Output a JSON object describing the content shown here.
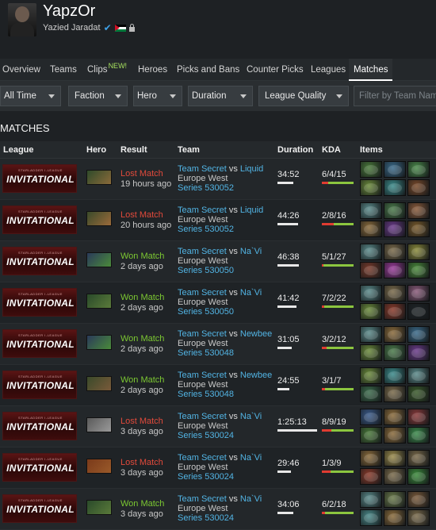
{
  "profile": {
    "player_name": "YapzOr",
    "real_name": "Yazied Jaradat",
    "verified_icon": "check-icon",
    "flag": "jordan-flag-icon",
    "lock_icon": "lock-icon"
  },
  "nav": {
    "tabs": [
      {
        "label": "Overview"
      },
      {
        "label": "Teams"
      },
      {
        "label": "Clips",
        "badge": "NEW!"
      },
      {
        "label": "Heroes"
      },
      {
        "label": "Picks and Bans"
      },
      {
        "label": "Counter Picks"
      },
      {
        "label": "Leagues"
      },
      {
        "label": "Matches",
        "active": true
      }
    ]
  },
  "filters": {
    "time": "All Time",
    "faction": "Faction",
    "hero": "Hero",
    "duration": "Duration",
    "league_quality": "League Quality",
    "search_placeholder": "Filter by Team Name"
  },
  "section_title": "MATCHES",
  "table": {
    "headers": {
      "league": "League",
      "hero": "Hero",
      "result": "Result",
      "team": "Team",
      "duration": "Duration",
      "kda": "KDA",
      "items": "Items"
    },
    "league_banner": {
      "small": "STARLADDER I-LEAGUE",
      "big": "INVITATIONAL"
    },
    "rows": [
      {
        "result": "Lost Match",
        "outcome": "lost",
        "time": "19 hours ago",
        "team": "Team Secret",
        "vs": "vs",
        "opponent": "Liquid",
        "region": "Europe West",
        "series": "Series 530052",
        "duration": "34:52",
        "duration_seconds": 2092,
        "kda": "6/4/15",
        "kills": 6,
        "deaths": 4,
        "assists": 15,
        "hero_colors": [
          "#2f4a2a",
          "#8a6a3a"
        ],
        "item_colors": [
          "#4a7a3a",
          "#3a6a8a",
          "#4a8a4a",
          "#6a8a3a",
          "#3a8a8a",
          "#7a4a2a"
        ]
      },
      {
        "result": "Lost Match",
        "outcome": "lost",
        "time": "20 hours ago",
        "team": "Team Secret",
        "vs": "vs",
        "opponent": "Liquid",
        "region": "Europe West",
        "series": "Series 530052",
        "duration": "44:26",
        "duration_seconds": 2666,
        "kda": "2/8/16",
        "kills": 2,
        "deaths": 8,
        "assists": 16,
        "hero_colors": [
          "#3a4a2a",
          "#9a6a3a"
        ],
        "item_colors": [
          "#5a8a8a",
          "#4a7a4a",
          "#8a5a3a",
          "#8a6a3a",
          "#6a3a8a",
          "#7a5a2a"
        ]
      },
      {
        "result": "Won Match",
        "outcome": "won",
        "time": "2 days ago",
        "team": "Team Secret",
        "vs": "vs",
        "opponent": "Na`Vi",
        "region": "Europe West",
        "series": "Series 530050",
        "duration": "46:38",
        "duration_seconds": 2798,
        "kda": "5/1/27",
        "kills": 5,
        "deaths": 1,
        "assists": 27,
        "hero_colors": [
          "#2a3a5a",
          "#4a8a3a"
        ],
        "item_colors": [
          "#5a8a8a",
          "#7a6a4a",
          "#8a8a3a",
          "#7a3a2a",
          "#9a3a9a",
          "#4a8a3a"
        ]
      },
      {
        "result": "Won Match",
        "outcome": "won",
        "time": "2 days ago",
        "team": "Team Secret",
        "vs": "vs",
        "opponent": "Na`Vi",
        "region": "Europe West",
        "series": "Series 530050",
        "duration": "41:42",
        "duration_seconds": 2502,
        "kda": "7/2/22",
        "kills": 7,
        "deaths": 2,
        "assists": 22,
        "hero_colors": [
          "#2a4a2a",
          "#5a7a3a"
        ],
        "item_colors": [
          "#5a8a8a",
          "#7a6a4a",
          "#8a5a7a",
          "#6a8a3a",
          "#8a3a2a",
          "#1e2326"
        ]
      },
      {
        "result": "Won Match",
        "outcome": "won",
        "time": "2 days ago",
        "team": "Team Secret",
        "vs": "vs",
        "opponent": "Newbee",
        "region": "Europe West",
        "series": "Series 530048",
        "duration": "31:05",
        "duration_seconds": 1865,
        "kda": "3/2/12",
        "kills": 3,
        "deaths": 2,
        "assists": 12,
        "hero_colors": [
          "#2a3a5a",
          "#4a8a3a"
        ],
        "item_colors": [
          "#5a8a8a",
          "#8a6a3a",
          "#3a6a8a",
          "#6a8a3a",
          "#4a7a4a",
          "#6a3a8a"
        ]
      },
      {
        "result": "Won Match",
        "outcome": "won",
        "time": "2 days ago",
        "team": "Team Secret",
        "vs": "vs",
        "opponent": "Newbee",
        "region": "Europe West",
        "series": "Series 530048",
        "duration": "24:55",
        "duration_seconds": 1495,
        "kda": "3/1/7",
        "kills": 3,
        "deaths": 1,
        "assists": 7,
        "hero_colors": [
          "#3a4a2a",
          "#7a5a3a"
        ],
        "item_colors": [
          "#6a8a3a",
          "#3a8a8a",
          "#5a8a8a",
          "#3a6a4a",
          "#7a6a4a",
          "#3a5a2a"
        ]
      },
      {
        "result": "Lost Match",
        "outcome": "lost",
        "time": "3 days ago",
        "team": "Team Secret",
        "vs": "vs",
        "opponent": "Na`Vi",
        "region": "Europe West",
        "series": "Series 530024",
        "duration": "1:25:13",
        "duration_seconds": 5113,
        "kda": "8/9/19",
        "kills": 8,
        "deaths": 9,
        "assists": 19,
        "hero_colors": [
          "#5a5a5a",
          "#9a9a9a"
        ],
        "item_colors": [
          "#3a5a8a",
          "#8a6a3a",
          "#8a3a3a",
          "#4a7a3a",
          "#8a6a3a",
          "#3a8a4a"
        ]
      },
      {
        "result": "Lost Match",
        "outcome": "lost",
        "time": "3 days ago",
        "team": "Team Secret",
        "vs": "vs",
        "opponent": "Na`Vi",
        "region": "Europe West",
        "series": "Series 530024",
        "duration": "29:46",
        "duration_seconds": 1786,
        "kda": "1/3/9",
        "kills": 1,
        "deaths": 3,
        "assists": 9,
        "hero_colors": [
          "#7a3a1a",
          "#9a5a2a"
        ],
        "item_colors": [
          "#8a6a3a",
          "#9a8a4a",
          "#7a6a4a",
          "#8a3a2a",
          "#7a6a4a",
          "#3a8a3a"
        ]
      },
      {
        "result": "Won Match",
        "outcome": "won",
        "time": "3 days ago",
        "team": "Team Secret",
        "vs": "vs",
        "opponent": "Na`Vi",
        "region": "Europe West",
        "series": "Series 530024",
        "duration": "34:06",
        "duration_seconds": 2046,
        "kda": "6/2/18",
        "kills": 6,
        "deaths": 2,
        "assists": 18,
        "hero_colors": [
          "#2a4a2a",
          "#5a7a3a"
        ],
        "item_colors": [
          "#5a8a8a",
          "#6a7a4a",
          "#7a5a3a",
          "#4a8a8a",
          "#8a6a3a",
          "#7a6a4a"
        ]
      }
    ]
  },
  "colors": {
    "won": "#7cc832",
    "lost": "#e24a3b",
    "link": "#52b4e4",
    "kills_bar": "#8cc63f",
    "deaths_bar": "#e03c31"
  }
}
